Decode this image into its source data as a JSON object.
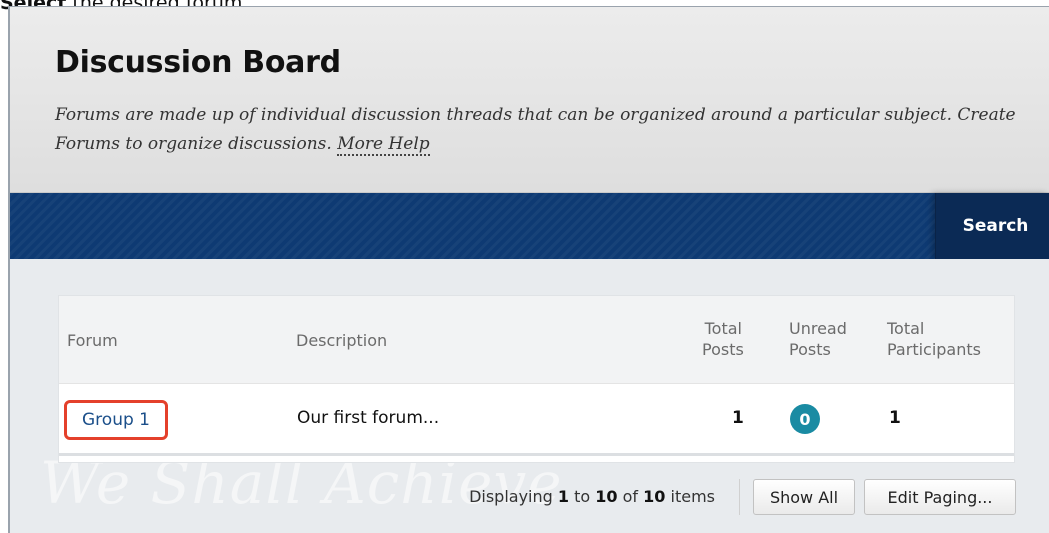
{
  "instruction": {
    "verb": "Select",
    "rest": "the desired forum."
  },
  "header": {
    "title": "Discussion Board",
    "description": "Forums are made up of individual discussion threads that can be organized around a particular subject. Create Forums to organize discussions.",
    "more_help": "More Help"
  },
  "navbar": {
    "search_label": "Search"
  },
  "table": {
    "headers": {
      "forum": "Forum",
      "description": "Description",
      "total_posts_1": "Total",
      "total_posts_2": "Posts",
      "unread_posts_1": "Unread",
      "unread_posts_2": "Posts",
      "total_participants_1": "Total",
      "total_participants_2": "Participants"
    },
    "rows": [
      {
        "forum": "Group 1",
        "description": "Our first forum...",
        "total_posts": "1",
        "unread_posts": "0",
        "total_participants": "1"
      }
    ]
  },
  "pager": {
    "displaying": "Displaying",
    "from": "1",
    "to_word": "to",
    "to": "10",
    "of_word": "of",
    "total": "10",
    "items_word": "items",
    "show_all_label": "Show All",
    "edit_paging_label": "Edit Paging..."
  },
  "watermark": "We Shall Achieve",
  "colors": {
    "navbar": "#0e3a73",
    "search_button": "#0b2a55",
    "badge": "#1a8ba3",
    "highlight": "#e4402b"
  }
}
